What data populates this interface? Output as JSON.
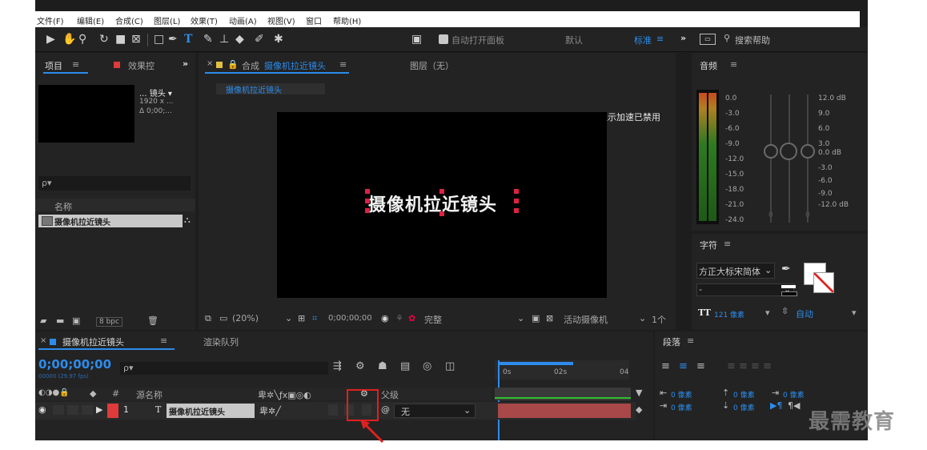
{
  "menu": [
    "文件(F)",
    "编辑(E)",
    "合成(C)",
    "图层(L)",
    "效果(T)",
    "动画(A)",
    "视图(V)",
    "窗口",
    "帮助(H)"
  ],
  "toolbar": {
    "auto_open": "自动打开面板",
    "workspace_default": "默认",
    "workspace_standard": "标准",
    "more": "»",
    "search_placeholder": "搜索帮助"
  },
  "project": {
    "tab_label": "项目",
    "effects_tab": "效果控",
    "more": "»",
    "thumb_title": "... 镜头 ▾",
    "thumb_dims": "1920 x ...",
    "thumb_time": "Δ 0;00;...",
    "search_placeholder": "ρ▾",
    "column_name": "名称",
    "item_name": "摄像机拉近镜头",
    "bpc": "8 bpc"
  },
  "composition": {
    "tab_prefix": "合成",
    "tab_name": "摄像机拉近镜头",
    "layer_tab": "图层（无）",
    "breadcrumb": "摄像机拉近镜头",
    "gpu_notice": "显示加速已禁用",
    "canvas_text": "摄像机拉近镜头",
    "zoom": "(20%)",
    "timecode": "0;00;00;00",
    "quality": "完整",
    "camera": "活动摄像机",
    "views": "1个"
  },
  "audio": {
    "title": "音频",
    "left_scale": [
      "0.0",
      "-3.0",
      "-6.0",
      "-9.0",
      "-12.0",
      "-15.0",
      "-18.0",
      "-21.0",
      "-24.0"
    ],
    "right_scale": [
      "12.0 dB",
      "9.0",
      "6.0",
      "3.0",
      "0.0 dB",
      "-3.0",
      "-6.0",
      "-9.0",
      "-12.0 dB"
    ],
    "slider_values": [
      "0",
      "0"
    ]
  },
  "character": {
    "title": "字符",
    "font": "方正大标宋简体",
    "style": "-",
    "size": "121 像素",
    "leading": "自动"
  },
  "timeline": {
    "tab_name": "摄像机拉近镜头",
    "render_queue": "渲染队列",
    "timecode": "0;00;00;00",
    "fps": "00000 (29.97 fps)",
    "search_placeholder": "ρ▾",
    "col_source": "源名称",
    "col_parent": "父级",
    "ruler": [
      "0s",
      "02s",
      "04"
    ],
    "layer_index": "1",
    "layer_type": "T",
    "layer_name": "摄像机拉近镜头",
    "layer_parent": "无"
  },
  "paragraph": {
    "title": "段落",
    "indent_left": "0 像素",
    "indent_right": "0 像素",
    "space_before": "0 像素",
    "space_after": "0 像素",
    "first_line": "0 像素"
  },
  "watermark": "最需教育",
  "colors": {
    "accent": "#2d8ceb",
    "label_red": "#e03a3a",
    "annotation": "#e02020"
  }
}
